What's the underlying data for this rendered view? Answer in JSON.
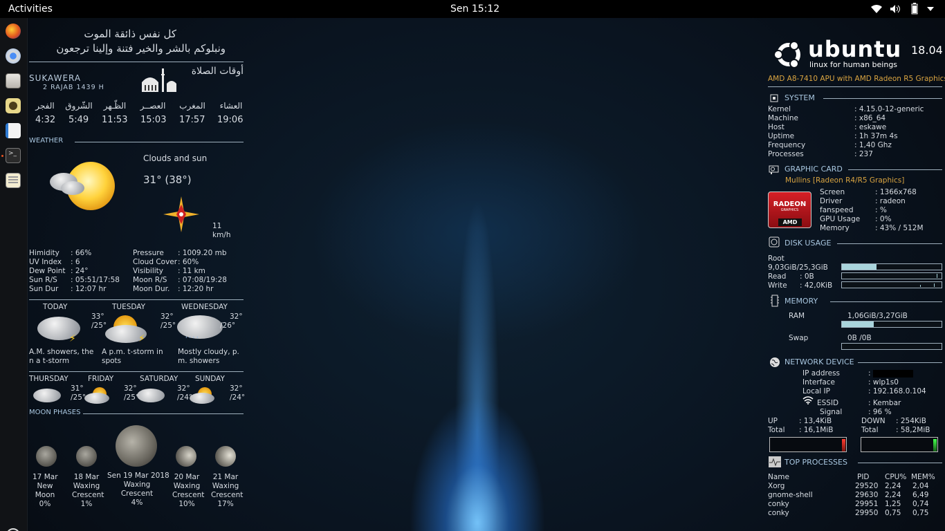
{
  "topbar": {
    "activities": "Activities",
    "clock": "Sen 15:12"
  },
  "dock": [
    "firefox-icon",
    "chromium-icon",
    "files-icon",
    "rhythmbox-icon",
    "writer-icon",
    "terminal-icon",
    "text-editor-icon",
    "show-apps-icon"
  ],
  "quote": {
    "line1": "كل نفس ذائقة الموت",
    "line2": "ونبلوكم بالشر والخير فتنة  وإلينا ترجعون"
  },
  "prayer": {
    "city": "SUKAWERA",
    "hijri": "2 RAJAB 1439 H",
    "title": "أوقات الصلاة",
    "names": [
      "العشاء",
      "المغرب",
      "العصــر",
      "الظّـهر",
      "الشّروق",
      "الفجر"
    ],
    "times": [
      "19:06",
      "17:57",
      "15:03",
      "11:53",
      "5:49",
      "4:32"
    ]
  },
  "weather": {
    "section": "WEATHER",
    "condition": "Clouds and sun",
    "temp": "31° (38°)",
    "wind_speed": "11",
    "wind_unit": "km/h",
    "left": [
      [
        "Himidity",
        ": 66%"
      ],
      [
        "UV Index",
        ": 6"
      ],
      [
        "Dew Point",
        ": 24°"
      ],
      [
        "Sun R/S",
        ": 05:51/17:58"
      ],
      [
        "Sun Dur",
        ": 12:07 hr"
      ]
    ],
    "right": [
      [
        "Pressure",
        ": 1009.20 mb"
      ],
      [
        "Cloud Cover",
        ": 60%"
      ],
      [
        "Visibility",
        ": 11 km"
      ],
      [
        "Moon R/S",
        ": 07:08/19:28"
      ],
      [
        "Moon Dur.",
        ": 12:20 hr"
      ]
    ],
    "days3": [
      {
        "day": "TODAY",
        "hi": "33°",
        "lo": "/25°",
        "desc1": "A.M. showers, the",
        "desc2": "n a t-storm"
      },
      {
        "day": "TUESDAY",
        "hi": "32°",
        "lo": "/25°",
        "desc1": "A p.m. t-storm in",
        "desc2": "spots"
      },
      {
        "day": "WEDNESDAY",
        "hi": "32°",
        "lo": "/26°",
        "desc1": "Mostly cloudy, p.",
        "desc2": "m. showers"
      }
    ],
    "days4": [
      {
        "day": "THURSDAY",
        "hi": "31°",
        "lo": "/25°"
      },
      {
        "day": "FRIDAY",
        "hi": "32°",
        "lo": "/25°"
      },
      {
        "day": "SATURDAY",
        "hi": "32°",
        "lo": "/24°"
      },
      {
        "day": "SUNDAY",
        "hi": "32°",
        "lo": "/24°"
      }
    ]
  },
  "moon": {
    "section": "MOON PHASES",
    "phases": [
      {
        "l1": "17 Mar",
        "l2": "New",
        "l3": "Moon",
        "l4": "0%"
      },
      {
        "l1": "18 Mar",
        "l2": "Waxing",
        "l3": "Crescent",
        "l4": "1%"
      },
      {
        "l1": "Sen 19 Mar 2018",
        "l2": "Waxing",
        "l3": "Crescent",
        "l4": "4%"
      },
      {
        "l1": "20 Mar",
        "l2": "Waxing",
        "l3": "Crescent",
        "l4": "10%"
      },
      {
        "l1": "21 Mar",
        "l2": "Waxing",
        "l3": "Crescent",
        "l4": "17%"
      }
    ]
  },
  "sys": {
    "brand": "ubuntu",
    "tagline": "linux for human beings",
    "version": "18.04",
    "cpu": "AMD A8-7410 APU with AMD Radeon R5 Graphics",
    "system_title": "SYSTEM",
    "system": [
      [
        "Kernel",
        ": 4.15.0-12-generic"
      ],
      [
        "Machine",
        ": x86_64"
      ],
      [
        "Host",
        ": eskawe"
      ],
      [
        "Uptime",
        ": 1h 37m 4s"
      ],
      [
        "Frequency",
        ": 1,40 Ghz"
      ],
      [
        "Processes",
        ": 237"
      ]
    ],
    "gpu_title": "GRAPHIC CARD",
    "gpu_name": "Mullins [Radeon R4/R5 Graphics]",
    "radeon": "RADEON",
    "radeon_sub": "GRAPHICS",
    "amd": "AMD",
    "gpu": [
      [
        "Screen",
        ": 1366x768"
      ],
      [
        "Driver",
        ": radeon"
      ],
      [
        "fanspeed",
        ":  %"
      ],
      [
        "GPU Usage",
        ": 0%"
      ],
      [
        "Memory",
        ": 43% / 512M"
      ]
    ],
    "disk_title": "DISK USAGE",
    "root": "Root",
    "root_val": "9,03GiB/25,3GiB",
    "root_frac": 0.35,
    "read": "Read",
    "read_val": ": 0B",
    "write": "Write",
    "write_val": ": 42,0KiB",
    "mem_title": "MEMORY",
    "ram": "RAM",
    "ram_val": "1,06GiB/3,27GiB",
    "ram_frac": 0.32,
    "swap": "Swap",
    "swap_val": "0B  /0B",
    "swap_frac": 0,
    "net_title": "NETWORK DEVICE",
    "net": [
      [
        "IP address",
        ": "
      ],
      [
        "Interface",
        ": wlp1s0"
      ],
      [
        "Local IP",
        ": 192.168.0.104"
      ]
    ],
    "essid": "ESSID",
    "essid_val": ": Kembar",
    "signal": "Signal",
    "signal_val": ": 96 %",
    "up": "UP",
    "up_val": ": 13,4KiB",
    "down": "DOWN",
    "down_val": ":  254KiB",
    "total": "Total",
    "up_total": ": 16,1MiB",
    "down_total": ": 58,2MiB",
    "top_title": "TOP PROCESSES",
    "top_head": [
      "Name",
      "PID",
      "CPU%",
      "MEM%"
    ],
    "top": [
      [
        "Xorg",
        "29520",
        "2,24",
        "2,04"
      ],
      [
        "gnome-shell",
        "29630",
        "2,24",
        "6,49"
      ],
      [
        "conky",
        "29951",
        "1,25",
        "0,74"
      ],
      [
        "conky",
        "29950",
        "0,75",
        "0,75"
      ]
    ]
  }
}
